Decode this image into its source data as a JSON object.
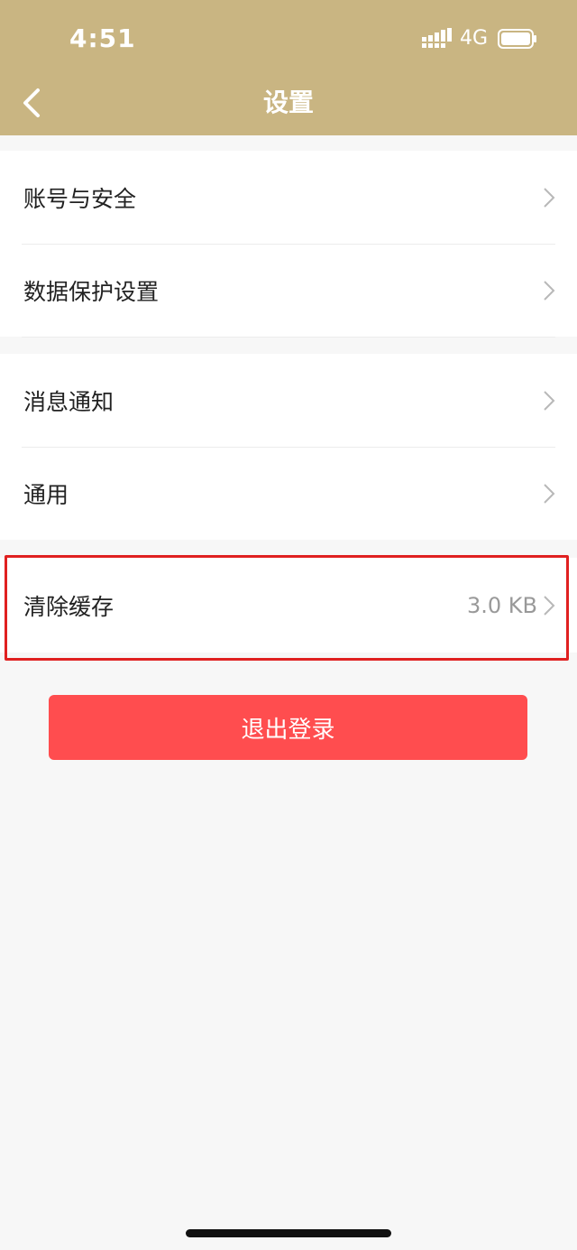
{
  "status_bar": {
    "time": "4:51",
    "network": "4G",
    "icons": [
      "signal-icon",
      "battery-icon"
    ]
  },
  "nav": {
    "title": "设置",
    "back_icon": "chevron-left-icon"
  },
  "groups": [
    {
      "items": [
        {
          "label": "账号与安全"
        },
        {
          "label": "数据保护设置"
        }
      ]
    },
    {
      "items": [
        {
          "label": "消息通知"
        },
        {
          "label": "通用"
        }
      ]
    },
    {
      "items": [
        {
          "label": "清除缓存",
          "value": "3.0 KB"
        }
      ]
    }
  ],
  "logout": {
    "label": "退出登录"
  },
  "colors": {
    "header": "#c9b582",
    "logout": "#ff4d4f",
    "highlight": "#e02020",
    "background": "#f7f7f7"
  }
}
